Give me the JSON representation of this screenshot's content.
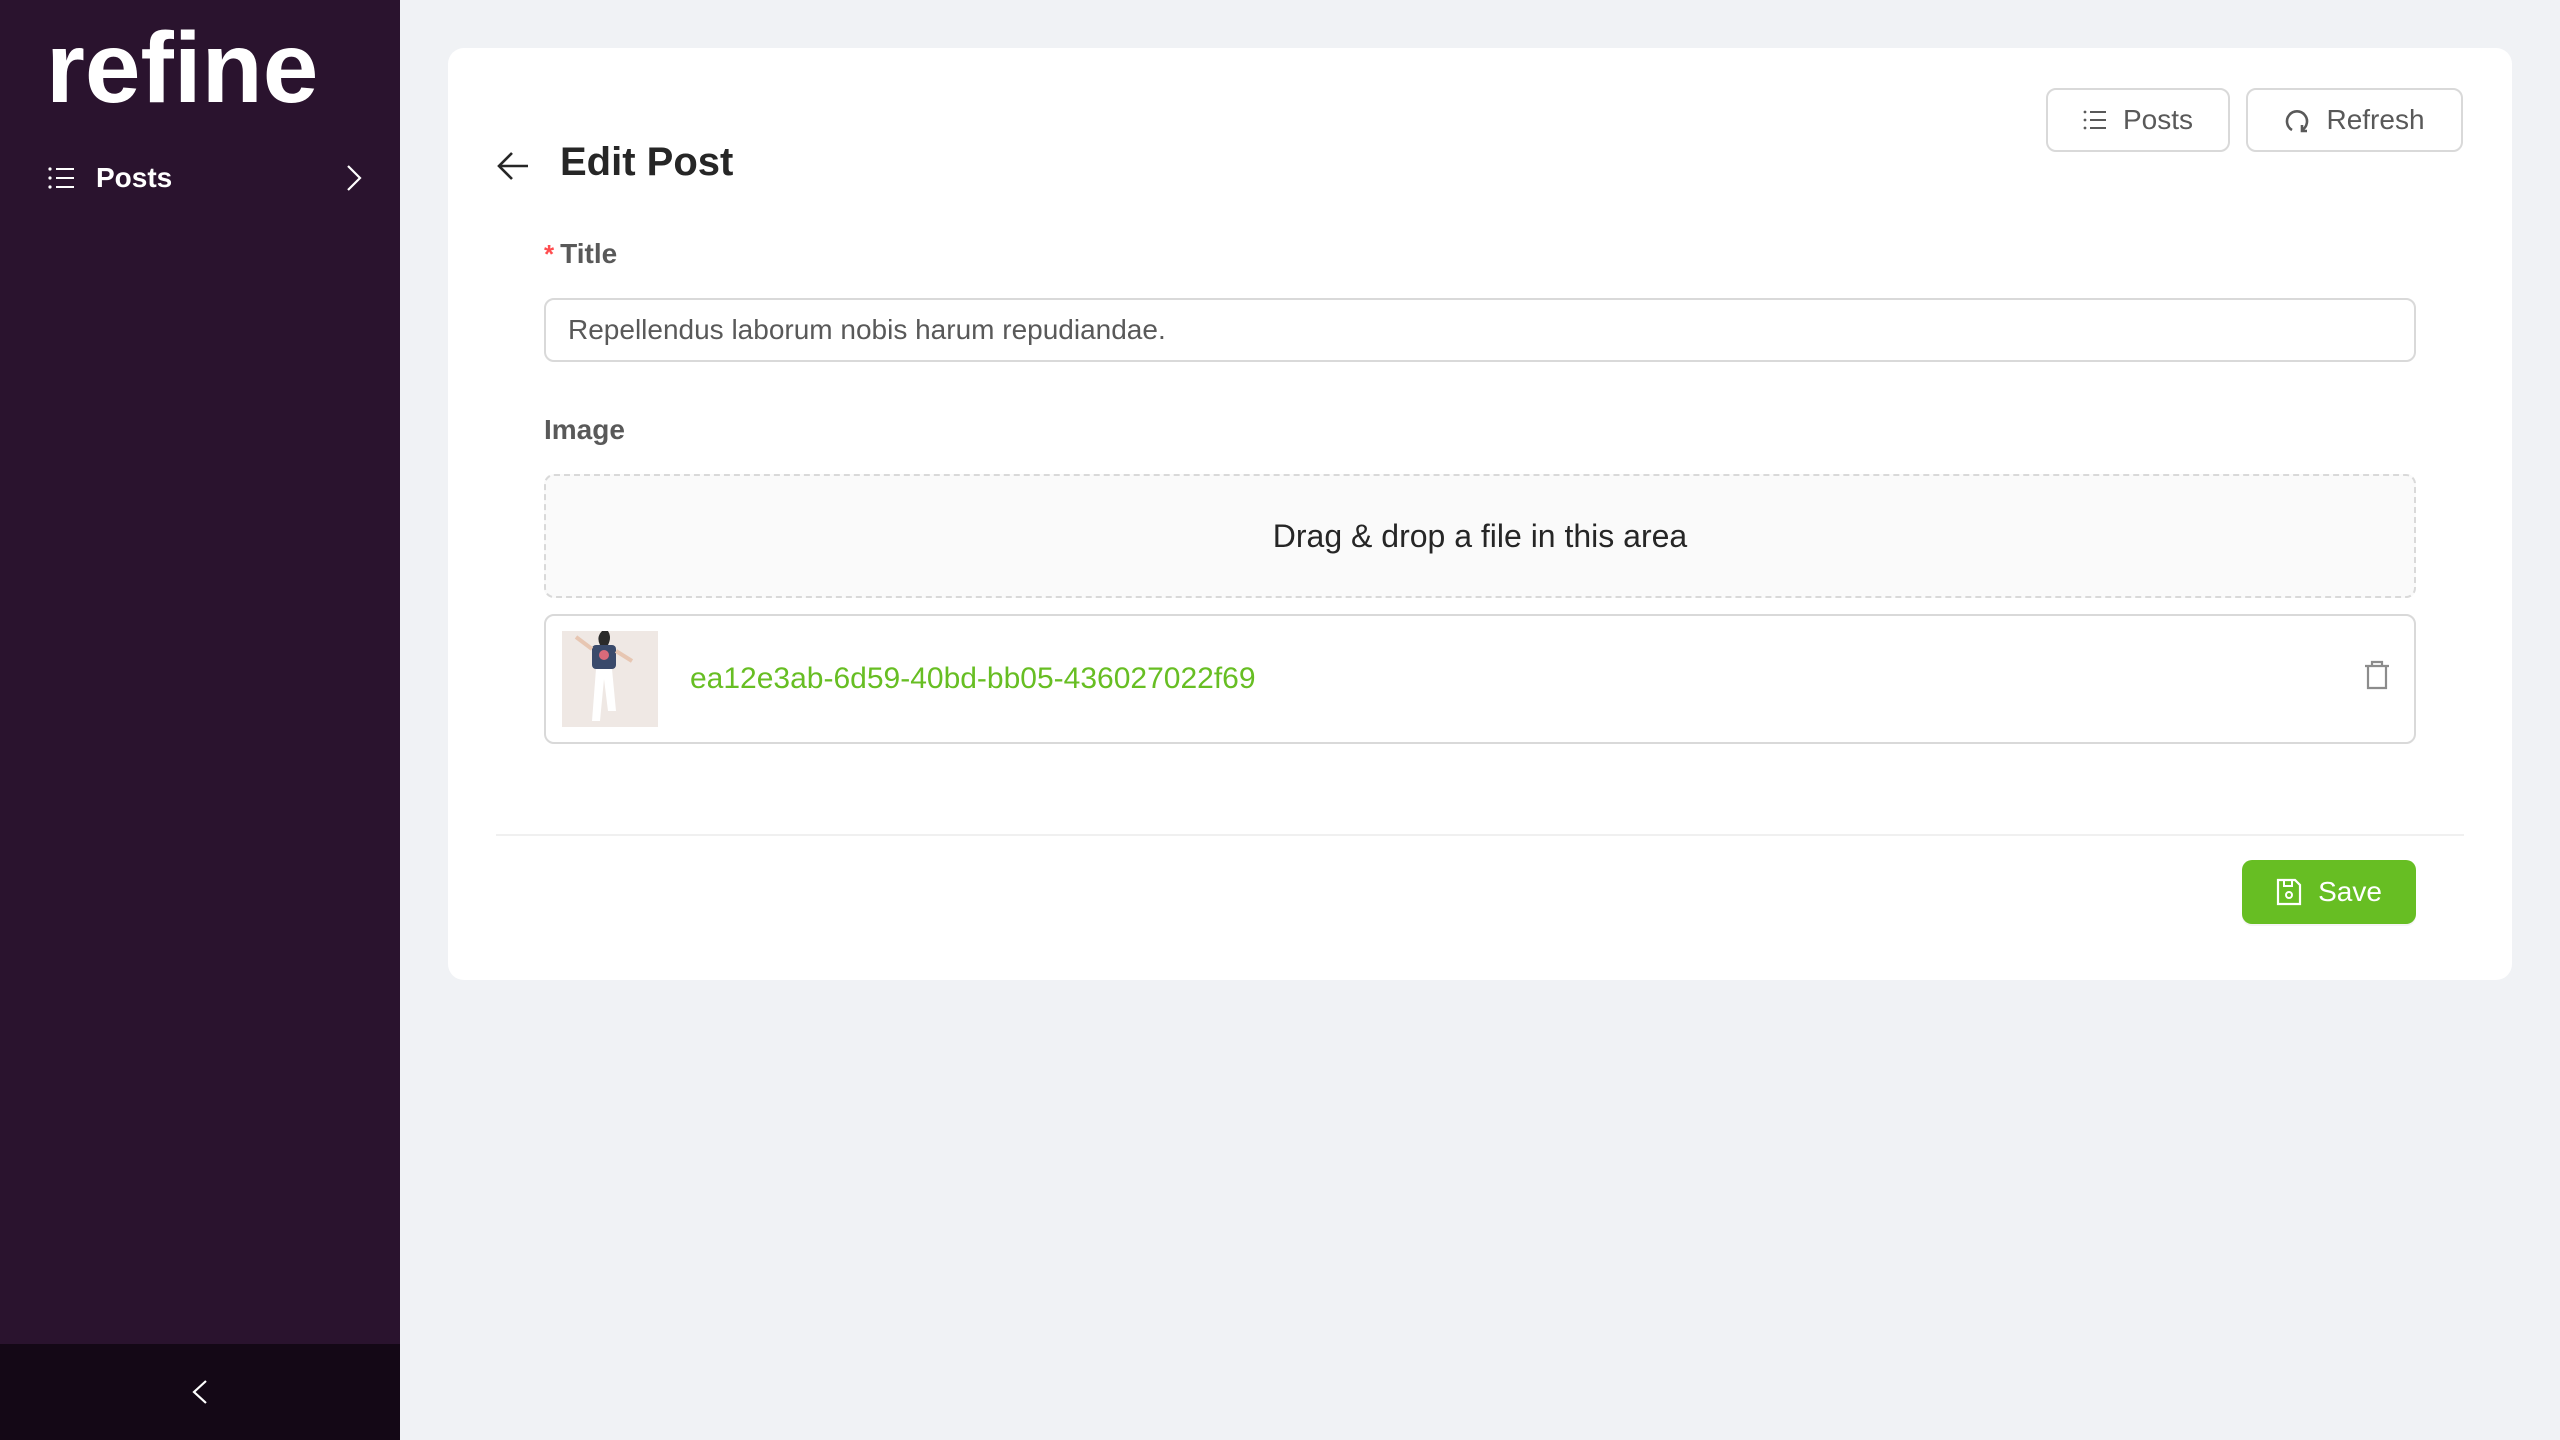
{
  "app": {
    "logo_text": "refine"
  },
  "sidebar": {
    "items": [
      {
        "label": "Posts",
        "icon": "list-icon"
      }
    ],
    "collapse_icon": "chevron-left-icon"
  },
  "header": {
    "title": "Edit Post",
    "back_icon": "arrow-left-icon",
    "buttons": [
      {
        "label": "Posts",
        "icon": "list-icon"
      },
      {
        "label": "Refresh",
        "icon": "refresh-icon"
      }
    ]
  },
  "form": {
    "title_field": {
      "label": "Title",
      "required": true,
      "value": "Repellendus laborum nobis harum repudiandae."
    },
    "image_field": {
      "label": "Image",
      "dropzone_text": "Drag & drop a file in this area",
      "files": [
        {
          "name": "ea12e3ab-6d59-40bd-bb05-436027022f69"
        }
      ]
    }
  },
  "footer": {
    "save_label": "Save",
    "save_icon": "save-icon"
  },
  "colors": {
    "sidebar": "#2a132e",
    "primary": "#67be23",
    "required": "#ff4d4f"
  }
}
